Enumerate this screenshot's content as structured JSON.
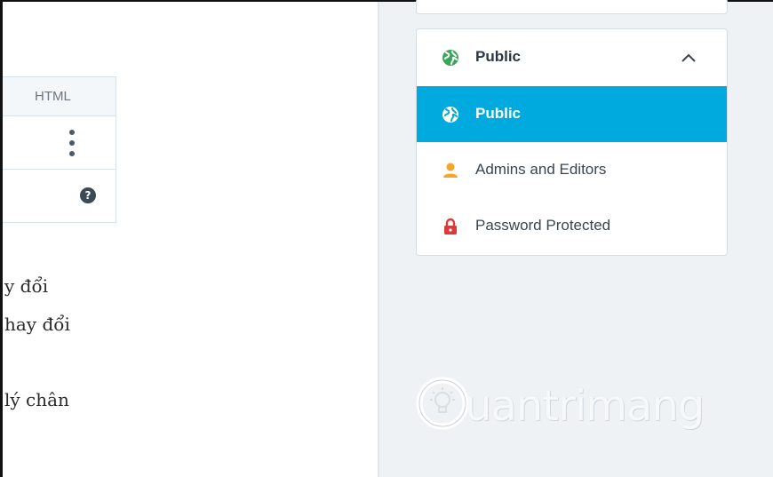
{
  "editor": {
    "tab_html": "HTML",
    "help_glyph": "?",
    "text_lines": [
      "y đổi",
      "hay đổi",
      "lý chân"
    ]
  },
  "visibility": {
    "selected": "Public",
    "options": [
      {
        "label": "Public",
        "icon": "globe-icon"
      },
      {
        "label": "Admins and Editors",
        "icon": "user-icon"
      },
      {
        "label": "Password Protected",
        "icon": "lock-icon"
      }
    ]
  },
  "colors": {
    "accent": "#00a9de",
    "globe_green": "#3ca55c",
    "user_orange": "#f5a623",
    "lock_red": "#d93a3a"
  },
  "watermark": {
    "text": "uantrimang"
  }
}
